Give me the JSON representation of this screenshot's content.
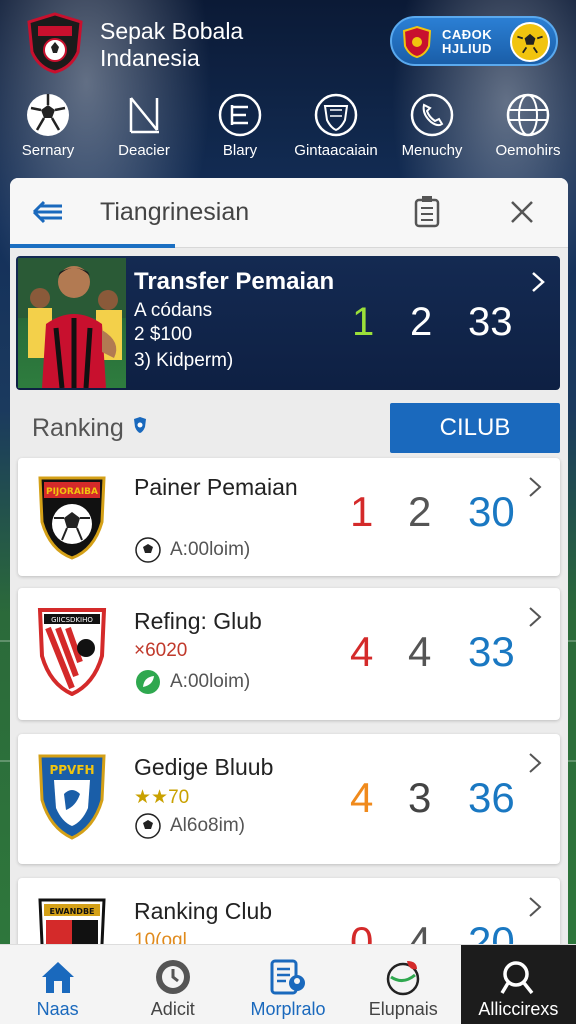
{
  "app": {
    "title_line1": "Sepak Bobala",
    "title_line2": "Indanesia"
  },
  "header_badge": {
    "line1": "CAÐOK",
    "line2": "HJLIUD"
  },
  "categories": [
    {
      "label": "Sernary",
      "icon": "soccer-ball-icon"
    },
    {
      "label": "Deacier",
      "icon": "post-icon"
    },
    {
      "label": "Blary",
      "icon": "list-icon"
    },
    {
      "label": "Gintaacaiain",
      "icon": "shield-emblem-icon"
    },
    {
      "label": "Menuchy",
      "icon": "phone-icon"
    },
    {
      "label": "Oemohirs",
      "icon": "globe-ball-icon"
    }
  ],
  "panel": {
    "title": "Tiangrinesian"
  },
  "feature": {
    "title": "Transfer Pemaian",
    "line1": "A códans",
    "line2": "2 $100",
    "line3": "3)  Kidperm)",
    "numbers": [
      "1",
      "2",
      "33"
    ],
    "colors": [
      "#9be03a",
      "#ffffff",
      "#ffffff"
    ]
  },
  "ranking": {
    "label": "Ranking",
    "club_button": "CILUB"
  },
  "clubs": [
    {
      "name": "Painer Pemaian",
      "sub": "",
      "meta": "A:00loim)",
      "meta_icon": "soccer-ball-icon",
      "numbers": [
        "1",
        "2",
        "30"
      ],
      "colors": [
        "#d42a2a",
        "#555555",
        "#1a78c2"
      ],
      "crest_text": "PIJORAIBA"
    },
    {
      "name": "Refing: Glub",
      "sub": "×6020",
      "sub_color": "#c0392b",
      "meta": "A:00loim)",
      "meta_icon": "leaf-icon",
      "numbers": [
        "4",
        "4",
        "33"
      ],
      "colors": [
        "#d42a2a",
        "#555555",
        "#1a78c2"
      ],
      "crest_text": "GIICSDKIHO"
    },
    {
      "name": "Gedige Bluub",
      "sub": "★★70",
      "sub_color": "#c9a100",
      "meta": "Al6o8im)",
      "meta_icon": "soccer-ball-icon",
      "numbers": [
        "4",
        "3",
        "36"
      ],
      "colors": [
        "#f08a1c",
        "#444444",
        "#1a78c2"
      ],
      "crest_text": "PPVFH"
    },
    {
      "name": "Ranking Club",
      "sub": "10(ogl",
      "sub_color": "#e08a1c",
      "meta": "",
      "meta_icon": "",
      "numbers": [
        "0",
        "4",
        "20"
      ],
      "colors": [
        "#d42a2a",
        "#555555",
        "#1a78c2"
      ],
      "crest_text": "EWANDBE"
    }
  ],
  "bottom_nav": [
    {
      "label": "Naas",
      "icon": "home-icon"
    },
    {
      "label": "Adicit",
      "icon": "clock-icon"
    },
    {
      "label": "Morplralo",
      "icon": "profile-card-icon"
    },
    {
      "label": "Elupnais",
      "icon": "globe-leaf-icon"
    },
    {
      "label": "Alliccirexs",
      "icon": "search-icon"
    }
  ]
}
